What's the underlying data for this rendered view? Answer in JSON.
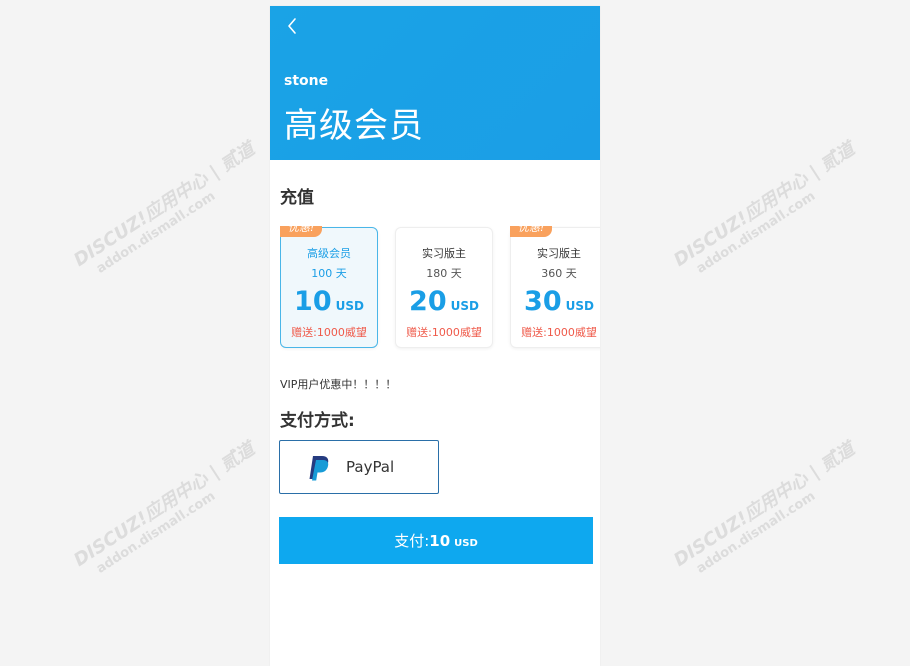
{
  "header": {
    "back_icon": "chevron-left-icon",
    "username": "stone",
    "title": "高级会员",
    "color": "#1aa3e6"
  },
  "recharge": {
    "section_title": "充值",
    "plans": [
      {
        "name": "高级会员",
        "days": "100 天",
        "price": "10",
        "currency": "USD",
        "bonus": "赠送:1000威望",
        "badge": "优惠!",
        "selected": true
      },
      {
        "name": "实习版主",
        "days": "180 天",
        "price": "20",
        "currency": "USD",
        "bonus": "赠送:1000威望",
        "badge": "",
        "selected": false
      },
      {
        "name": "实习版主",
        "days": "360 天",
        "price": "30",
        "currency": "USD",
        "bonus": "赠送:1000威望",
        "badge": "优惠!",
        "selected": false
      }
    ],
    "note": "VIP用户优惠中！！！！"
  },
  "payment": {
    "section_title": "支付方式:",
    "method": {
      "label": "PayPal",
      "icon": "paypal-icon"
    }
  },
  "pay_button": {
    "label": "支付:",
    "amount": "10",
    "currency": "USD",
    "color": "#0ea8ef"
  },
  "watermark": {
    "line1": "DISCUZ!应用中心 | 贰道",
    "line2": "addon.dismall.com"
  }
}
